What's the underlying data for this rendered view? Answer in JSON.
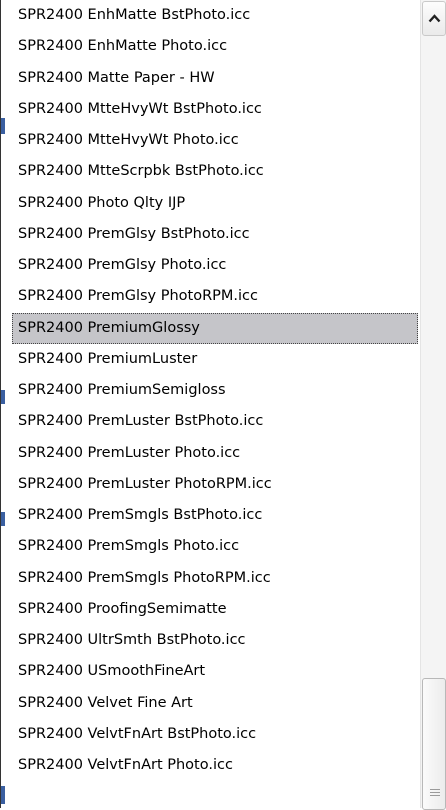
{
  "list": {
    "selected_index": 10,
    "items": [
      "SPR2400 EnhMatte BstPhoto.icc",
      "SPR2400 EnhMatte Photo.icc",
      "SPR2400 Matte Paper - HW",
      "SPR2400 MtteHvyWt BstPhoto.icc",
      "SPR2400 MtteHvyWt Photo.icc",
      "SPR2400 MtteScrpbk BstPhoto.icc",
      "SPR2400 Photo Qlty IJP",
      "SPR2400 PremGlsy BstPhoto.icc",
      "SPR2400 PremGlsy Photo.icc",
      "SPR2400 PremGlsy PhotoRPM.icc",
      "SPR2400 PremiumGlossy",
      "SPR2400 PremiumLuster",
      "SPR2400 PremiumSemigloss",
      "SPR2400 PremLuster BstPhoto.icc",
      "SPR2400 PremLuster Photo.icc",
      "SPR2400 PremLuster PhotoRPM.icc",
      "SPR2400 PremSmgls BstPhoto.icc",
      "SPR2400 PremSmgls Photo.icc",
      "SPR2400 PremSmgls PhotoRPM.icc",
      "SPR2400 ProofingSemimatte",
      "SPR2400 UltrSmth BstPhoto.icc",
      "SPR2400 USmoothFineArt",
      "SPR2400 Velvet Fine Art",
      "SPR2400 VelvtFnArt BstPhoto.icc",
      "SPR2400 VelvtFnArt Photo.icc"
    ]
  },
  "scrollbar": {
    "up_icon": "chevron-up-icon",
    "position": "bottom"
  },
  "colors": {
    "selection": "#c5c5c9",
    "text": "#000000"
  }
}
